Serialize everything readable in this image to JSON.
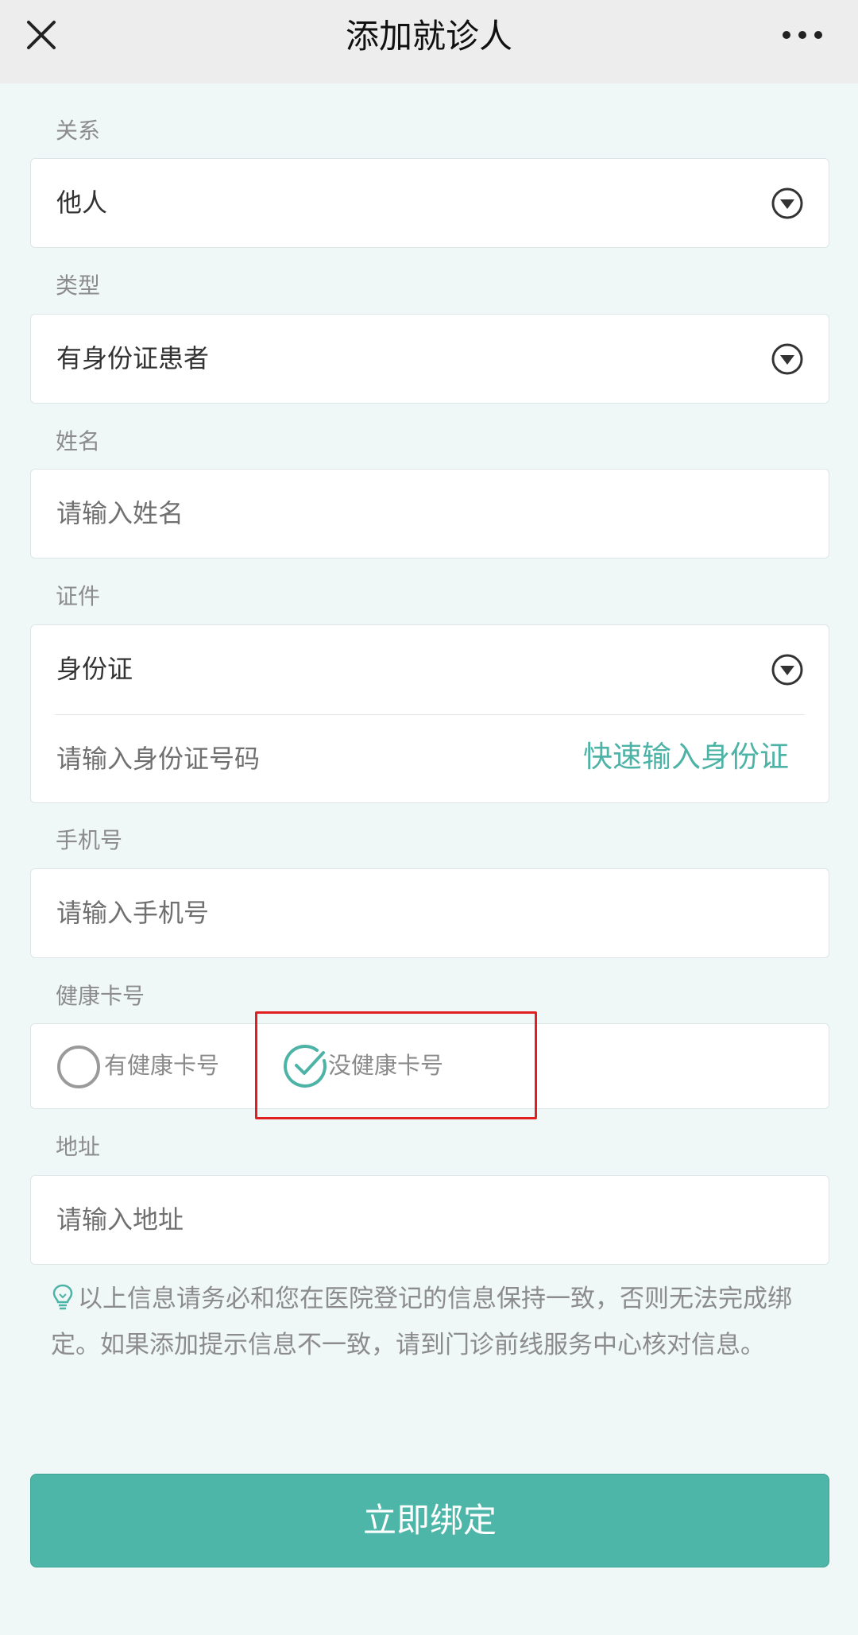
{
  "header": {
    "title": "添加就诊人",
    "close_icon": "close-icon",
    "more_icon": "more-icon"
  },
  "form": {
    "relation": {
      "label": "关系",
      "value": "他人"
    },
    "type": {
      "label": "类型",
      "value": "有身份证患者"
    },
    "name": {
      "label": "姓名",
      "placeholder": "请输入姓名"
    },
    "certificate": {
      "label": "证件",
      "value": "身份证",
      "number_placeholder": "请输入身份证号码",
      "quick_input": "快速输入身份证"
    },
    "phone": {
      "label": "手机号",
      "placeholder": "请输入手机号"
    },
    "health_card": {
      "label": "健康卡号",
      "options": [
        {
          "label": "有健康卡号",
          "selected": false
        },
        {
          "label": "没健康卡号",
          "selected": true
        }
      ]
    },
    "address": {
      "label": "地址",
      "placeholder": "请输入地址"
    }
  },
  "notice": {
    "icon": "lightbulb-icon",
    "text": "以上信息请务必和您在医院登记的信息保持一致，否则无法完成绑定。如果添加提示信息不一致，请到门诊前线服务中心核对信息。"
  },
  "submit_label": "立即绑定",
  "colors": {
    "accent": "#4db6a8",
    "highlight": "#e02020",
    "background": "#eff7f7"
  }
}
